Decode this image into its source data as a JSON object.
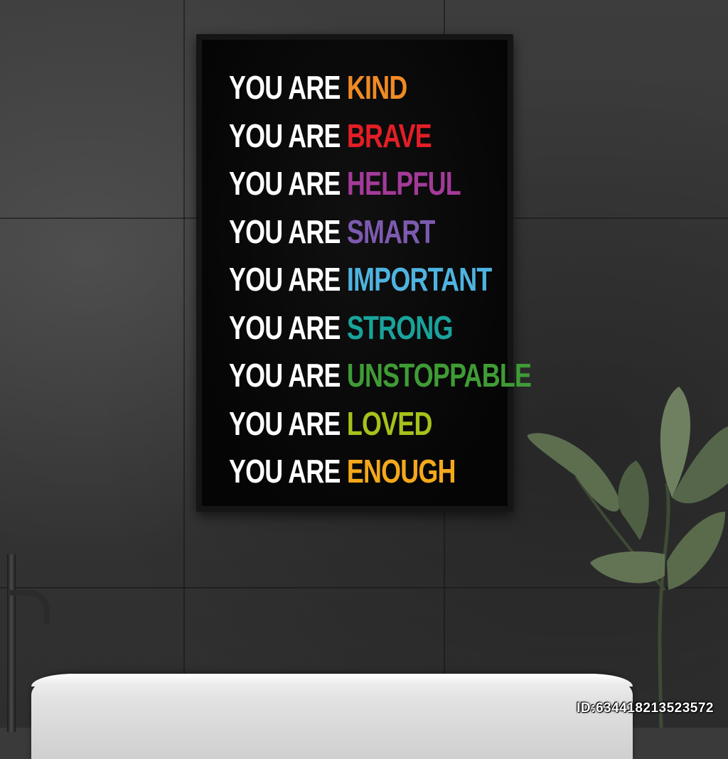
{
  "poster": {
    "lines": [
      {
        "lead": "YOU ARE",
        "word": "KIND",
        "color": "#f08a24"
      },
      {
        "lead": "YOU ARE",
        "word": "BRAVE",
        "color": "#e41e26"
      },
      {
        "lead": "YOU ARE",
        "word": "HELPFUL",
        "color": "#a33a98"
      },
      {
        "lead": "YOU ARE",
        "word": "SMART",
        "color": "#7d5ab0"
      },
      {
        "lead": "YOU ARE",
        "word": "IMPORTANT",
        "color": "#4fb3e0"
      },
      {
        "lead": "YOU ARE",
        "word": "STRONG",
        "color": "#19a39b"
      },
      {
        "lead": "YOU ARE",
        "word": "UNSTOPPABLE",
        "color": "#3f9c35"
      },
      {
        "lead": "YOU ARE",
        "word": "LOVED",
        "color": "#a6c21b"
      },
      {
        "lead": "YOU ARE",
        "word": "ENOUGH",
        "color": "#f4a81b"
      }
    ]
  },
  "watermark": "ID:634418213523572",
  "colors": {
    "wall": "#3a3a3a",
    "poster_background": "#050505",
    "lead_text": "#ffffff",
    "tub": "#e8e8e8",
    "leaf": "#5d6e4f"
  }
}
